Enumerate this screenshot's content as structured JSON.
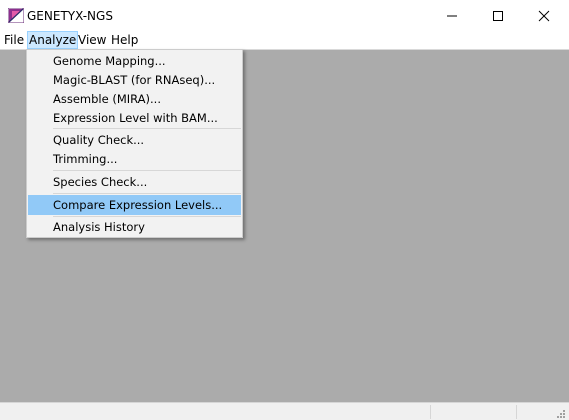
{
  "window": {
    "title": "GENETYX-NGS",
    "icon": "genetyx-app-icon"
  },
  "menubar": {
    "items": [
      {
        "label": "File"
      },
      {
        "label": "Analyze"
      },
      {
        "label": "View"
      },
      {
        "label": "Help"
      }
    ]
  },
  "analyze_menu": {
    "items": [
      {
        "label": "Genome Mapping..."
      },
      {
        "label": "Magic-BLAST (for RNAseq)..."
      },
      {
        "label": "Assemble (MIRA)..."
      },
      {
        "label": "Expression Level with BAM..."
      },
      {
        "label": "Quality Check..."
      },
      {
        "label": "Trimming..."
      },
      {
        "label": "Species Check..."
      },
      {
        "label": "Compare Expression Levels..."
      },
      {
        "label": "Analysis History"
      }
    ],
    "highlighted": "Compare Expression Levels..."
  },
  "colors": {
    "workspace": "#ababab",
    "menu_highlight": "#91c9f7",
    "menubar_active": "#cce8ff"
  }
}
